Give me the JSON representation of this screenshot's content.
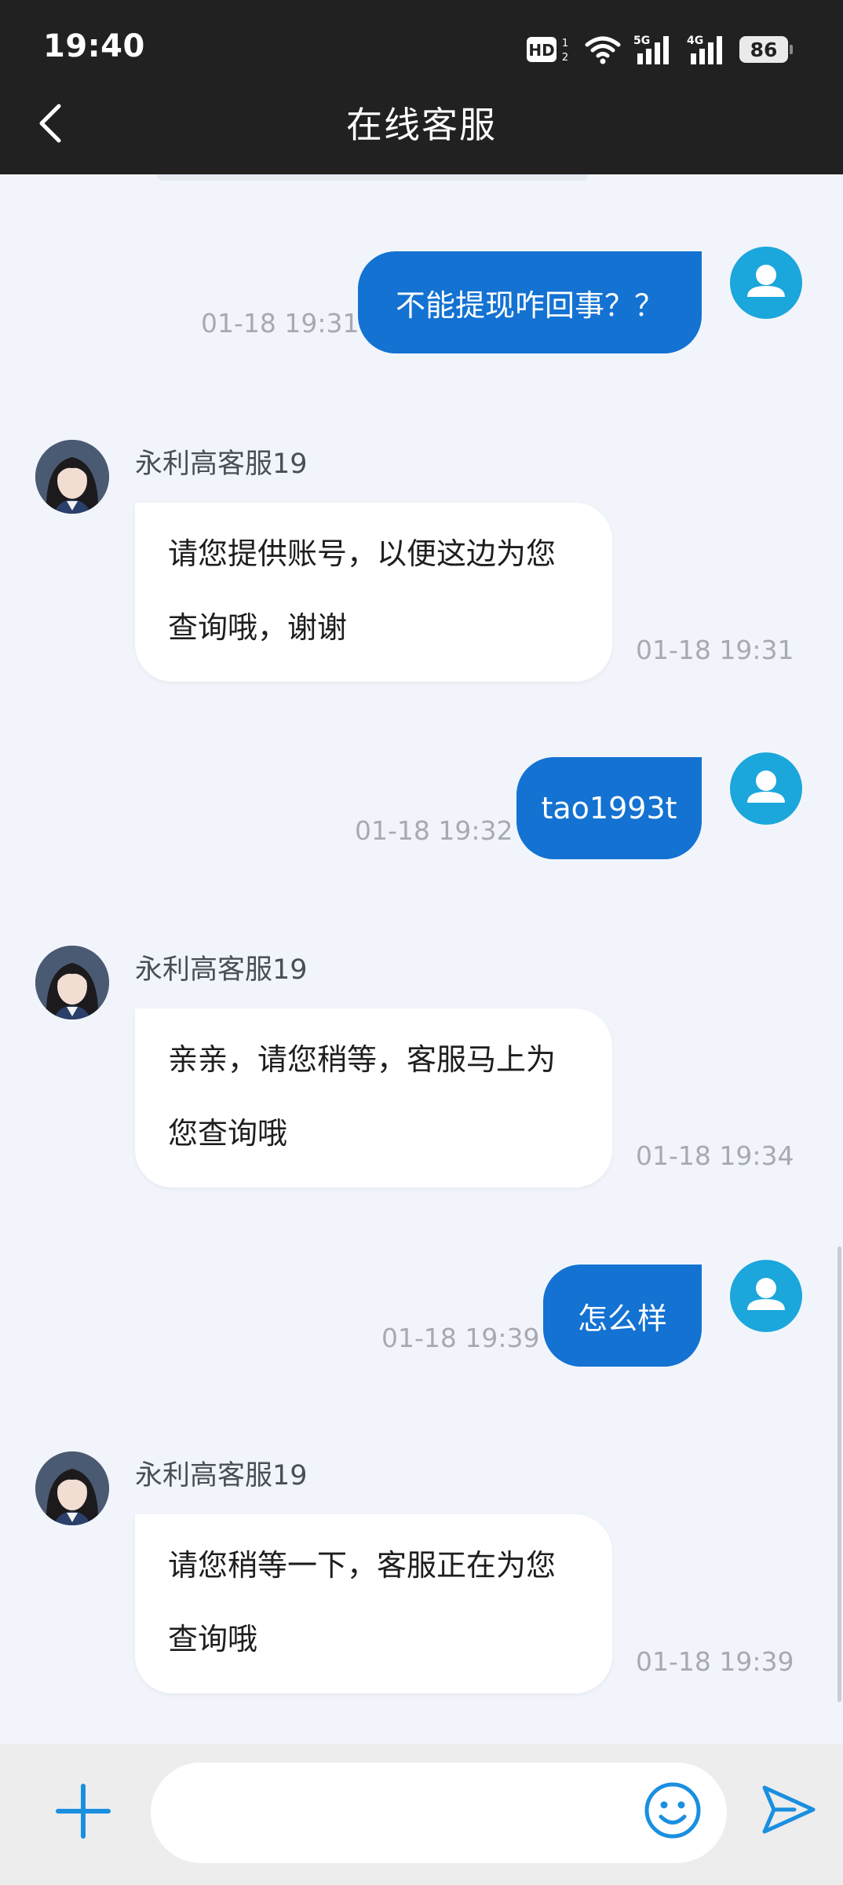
{
  "status_bar": {
    "time": "19:40",
    "battery": "86",
    "icons": [
      "hd-icon",
      "wifi-icon",
      "signal-5g-icon",
      "signal-4g-icon",
      "battery-icon"
    ]
  },
  "header": {
    "title": "在线客服",
    "back_icon": "chevron-left-icon"
  },
  "messages": [
    {
      "direction": "out",
      "text": "不能提现咋回事？？",
      "time": "01-18 19:31"
    },
    {
      "direction": "in",
      "sender": "永利高客服19",
      "lines": [
        "请您提供账号，以便这边为您",
        "查询哦，谢谢"
      ],
      "time": "01-18 19:31"
    },
    {
      "direction": "out",
      "text": "tao1993t",
      "time": "01-18 19:32"
    },
    {
      "direction": "in",
      "sender": "永利高客服19",
      "lines": [
        "亲亲，请您稍等，客服马上为",
        "您查询哦"
      ],
      "time": "01-18 19:34"
    },
    {
      "direction": "out",
      "text": "怎么样",
      "time": "01-18 19:39"
    },
    {
      "direction": "in",
      "sender": "永利高客服19",
      "lines": [
        "请您稍等一下，客服正在为您",
        "查询哦"
      ],
      "time": "01-18 19:39"
    }
  ],
  "input_bar": {
    "placeholder": "",
    "value": "",
    "icons": [
      "plus-icon",
      "emoji-icon",
      "send-icon"
    ]
  },
  "colors": {
    "header_bg": "#212121",
    "chat_bg": "#f1f5fb",
    "outgoing_bubble": "#1372d2",
    "incoming_bubble": "#ffffff",
    "user_avatar": "#1ba6dc",
    "accent_icon": "#1a8fe0",
    "timestamp": "#a7aab0"
  }
}
